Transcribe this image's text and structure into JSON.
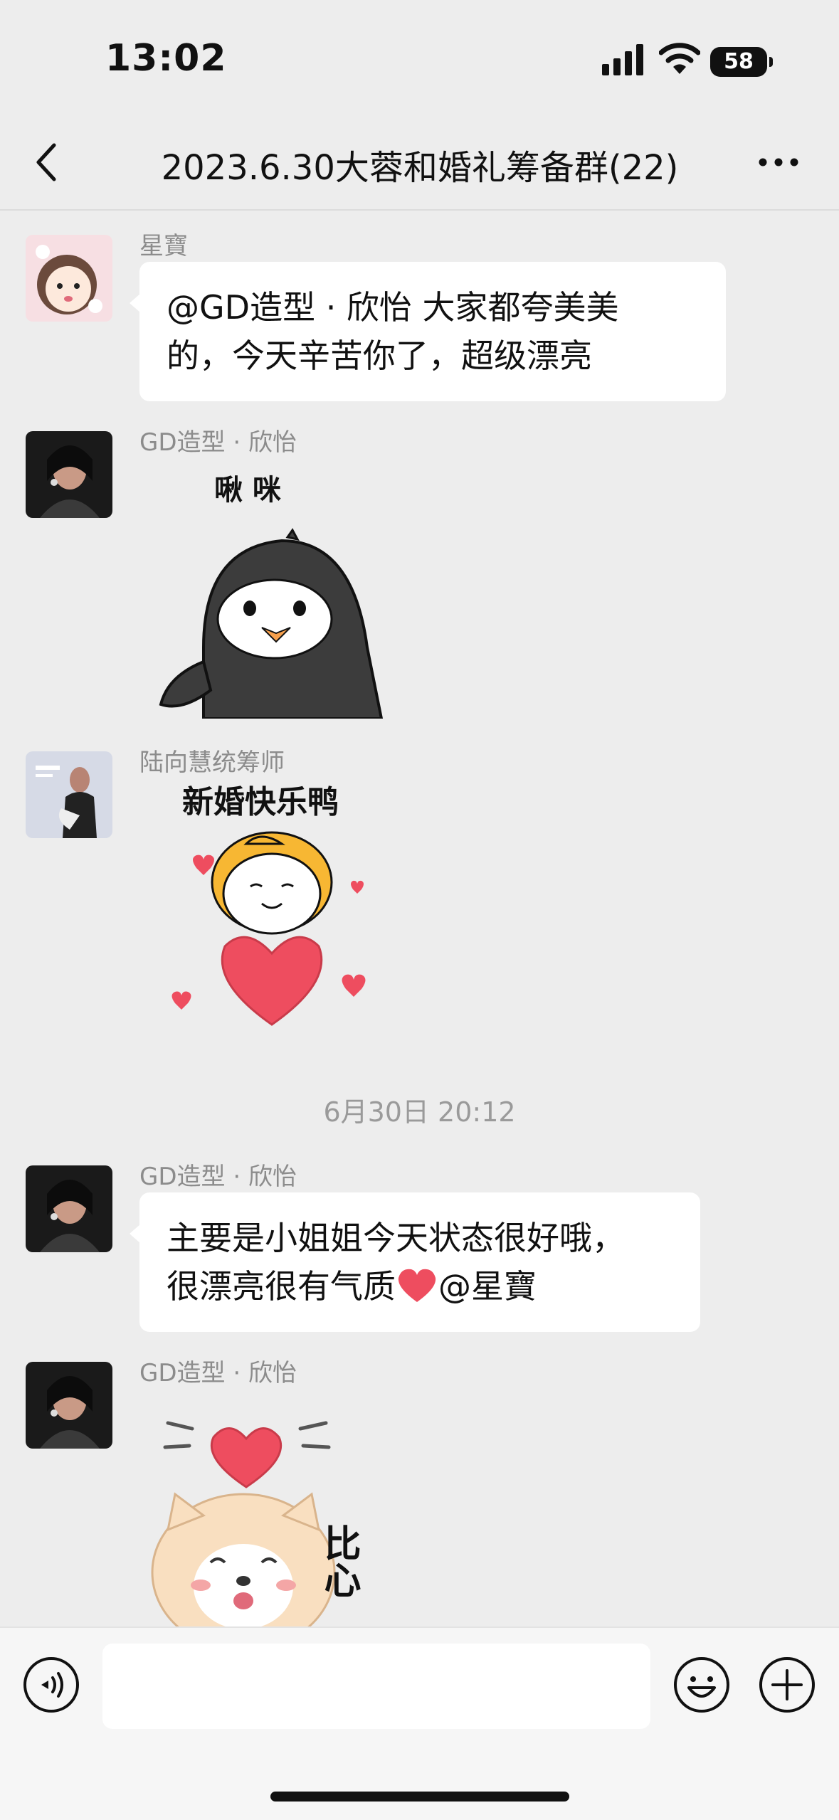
{
  "status_bar": {
    "time": "13:02",
    "battery": "58"
  },
  "header": {
    "title": "2023.6.30大蓉和婚礼筹备群(22)"
  },
  "messages": [
    {
      "sender": "星寶",
      "type": "text",
      "text_line1": "@GD造型 · 欣怡 大家都夸美美",
      "text_line2": "的，今天辛苦你了，超级漂亮"
    },
    {
      "sender": "GD造型 · 欣怡",
      "type": "sticker",
      "sticker_text": "啾 咪"
    },
    {
      "sender": "陆向慧统筹师",
      "type": "sticker",
      "sticker_text": "新婚快乐鸭"
    },
    {
      "sender": "GD造型 · 欣怡",
      "type": "text",
      "text_line1": "主要是小姐姐今天状态很好哦，",
      "text_line2": "很漂亮很有气质",
      "text_line2_suffix": "@星寶"
    },
    {
      "sender": "GD造型 · 欣怡",
      "type": "sticker",
      "sticker_text": "比心"
    }
  ],
  "timestamp": "6月30日 20:12",
  "colors": {
    "background": "#ededed",
    "bubble": "#ffffff",
    "heart": "#ee4d5f"
  },
  "icons": [
    "back-icon",
    "more-icon",
    "voice-icon",
    "emoji-icon",
    "plus-icon",
    "signal-icon",
    "wifi-icon",
    "battery-icon"
  ]
}
